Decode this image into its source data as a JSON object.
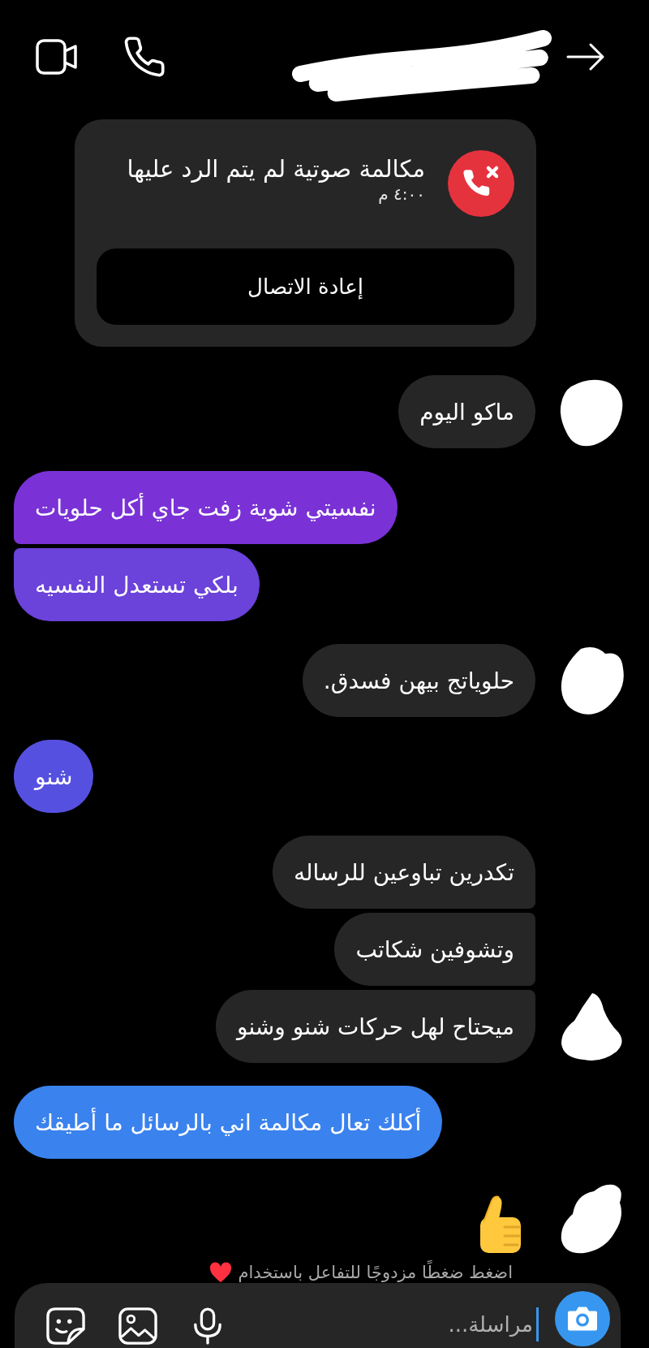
{
  "header": {
    "contact_name": {
      "kind": "scribbled"
    }
  },
  "call_card": {
    "kind": "missed_voice",
    "title": "مكالمة صوتية لم يتم الرد عليها",
    "time": "٤:٠٠ م",
    "button": "إعادة الاتصال"
  },
  "messages": [
    {
      "kind": "text",
      "outgoing": false,
      "text": "ماكو اليوم",
      "avatar": {
        "kind": "scribbled"
      }
    },
    {
      "kind": "text",
      "outgoing": true,
      "text": "نفسيتي شوية زفت جاي أكل حلويات",
      "color": "#7a32d6"
    },
    {
      "kind": "text",
      "outgoing": true,
      "text": "بلكي تستعدل النفسيه",
      "color": "#6b42da"
    },
    {
      "kind": "text",
      "outgoing": false,
      "text": "حلوياتج بيهن فسدق.",
      "avatar": {
        "kind": "scribbled"
      }
    },
    {
      "kind": "text",
      "outgoing": true,
      "text": "شنو",
      "color": "#5650e0"
    },
    {
      "kind": "text",
      "outgoing": false,
      "text": "تكدرين تباوعين للرساله"
    },
    {
      "kind": "text",
      "outgoing": false,
      "text": "وتشوفين شكاتب"
    },
    {
      "kind": "text",
      "outgoing": false,
      "text": "ميحتاح لهل حركات شنو وشنو",
      "avatar": {
        "kind": "scribbled"
      }
    },
    {
      "kind": "text",
      "outgoing": true,
      "text": "أكلك تعال مكالمة اني بالرسائل ما أطيقك",
      "color": "#3a82ee"
    },
    {
      "kind": "like",
      "outgoing": false,
      "avatar": {
        "kind": "scribbled"
      }
    }
  ],
  "hint": "اضغط ضغطًا مزدوجًا للتفاعل باستخدام",
  "composer": {
    "placeholder": "مراسلة..."
  }
}
